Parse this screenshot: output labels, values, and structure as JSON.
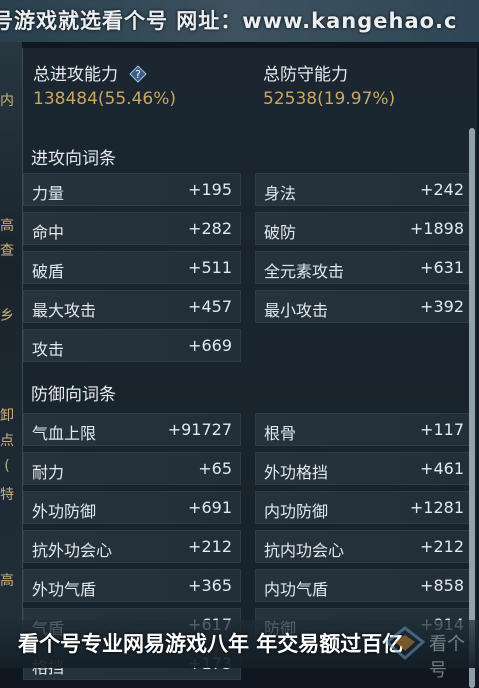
{
  "watermark": {
    "top": "号游戏就选看个号   网址：www.kangehao.c",
    "bottom": "看个号专业网易游戏八年   年交易额过百亿",
    "logo_text": "看个号"
  },
  "summary": {
    "attack_label": "总进攻能力",
    "attack_value": "138484(55.46%)",
    "defense_label": "总防守能力",
    "defense_value": "52538(19.97%)"
  },
  "attack_section": {
    "title": "进攻向词条",
    "rows": [
      {
        "name": "力量",
        "value": "+195"
      },
      {
        "name": "身法",
        "value": "+242"
      },
      {
        "name": "命中",
        "value": "+282"
      },
      {
        "name": "破防",
        "value": "+1898"
      },
      {
        "name": "破盾",
        "value": "+511"
      },
      {
        "name": "全元素攻击",
        "value": "+631"
      },
      {
        "name": "最大攻击",
        "value": "+457"
      },
      {
        "name": "最小攻击",
        "value": "+392"
      },
      {
        "name": "攻击",
        "value": "+669"
      }
    ]
  },
  "defense_section": {
    "title": "防御向词条",
    "rows": [
      {
        "name": "气血上限",
        "value": "+91727"
      },
      {
        "name": "根骨",
        "value": "+117"
      },
      {
        "name": "耐力",
        "value": "+65"
      },
      {
        "name": "外功格挡",
        "value": "+461"
      },
      {
        "name": "外功防御",
        "value": "+691"
      },
      {
        "name": "内功防御",
        "value": "+1281"
      },
      {
        "name": "抗外功会心",
        "value": "+212"
      },
      {
        "name": "抗内功会心",
        "value": "+212"
      },
      {
        "name": "外功气盾",
        "value": "+365"
      },
      {
        "name": "内功气盾",
        "value": "+858"
      },
      {
        "name": "气盾",
        "value": "+617"
      },
      {
        "name": "防御",
        "value": "+914"
      },
      {
        "name": "格挡",
        "value": "+173"
      }
    ]
  },
  "left_edge_glyphs": [
    "内",
    "高",
    "查",
    "乡",
    "卸",
    "点",
    "(",
    "特",
    "高"
  ],
  "colors": {
    "accent_gold": "#c9a760",
    "row_bg": "#26333d",
    "panel_bg": "#1b2630"
  }
}
